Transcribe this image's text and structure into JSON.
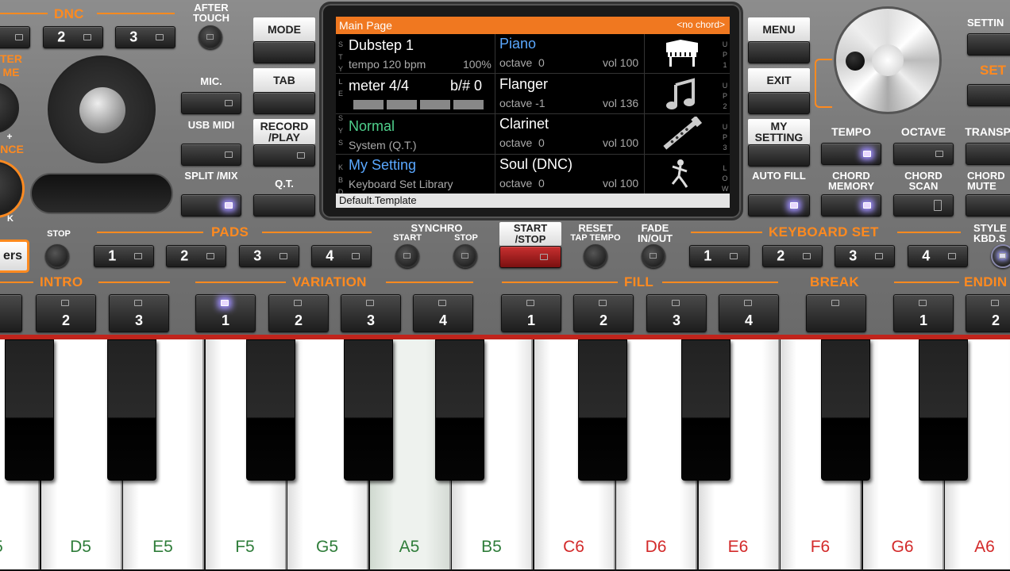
{
  "sections": {
    "dnc": "DNC",
    "pads": "PADS",
    "keyboard_set": "KEYBOARD SET",
    "intro": "INTRO",
    "variation": "VARIATION",
    "fill": "FILL",
    "break": "BREAK",
    "ending": "ENDIN"
  },
  "top_left": {
    "dnc_buttons": [
      "2",
      "3"
    ],
    "after_touch": "AFTER TOUCH",
    "ulab1": "TER\nME",
    "ulab2": "NCE",
    "plus": "+",
    "k": "K"
  },
  "mid_labels": {
    "mic": "MIC.",
    "usb_midi": "USB MIDI",
    "split_mix": "SPLIT /MIX",
    "mode": "MODE",
    "tab": "TAB",
    "record_play": "RECORD /PLAY",
    "qt": "Q.T.",
    "menu": "MENU",
    "exit": "EXIT",
    "my_setting": "MY SETTING",
    "auto_fill": "AUTO FILL"
  },
  "right_labels": {
    "setting": "SETTIN",
    "set": "SET",
    "tempo": "TEMPO",
    "octave": "OCTAVE",
    "transp": "TRANSP",
    "chord_memory": "CHORD MEMORY",
    "chord_scan": "CHORD SCAN",
    "chord_mute": "CHORD MUTE",
    "style_kbd": "STYLE KBD.S"
  },
  "screen": {
    "title": "Main Page",
    "no_chord": "<no chord>",
    "style_name": "Dubstep 1",
    "tempo": "tempo 120 bpm",
    "pct": "100%",
    "meter": "meter 4/4",
    "bsharp": "b/# 0",
    "sys_name": "Normal",
    "sys_sub": "System (Q.T.)",
    "kbd_name": "My Setting",
    "kbd_sub": "Keyboard Set Library",
    "footer": "Default.Template",
    "side_left": [
      "S",
      "T",
      "Y",
      "L",
      "E",
      "",
      "S",
      "Y",
      "S",
      "",
      "K",
      "B",
      "D"
    ],
    "side_right": [
      "U",
      "P",
      "1",
      "",
      "U",
      "P",
      "2",
      "",
      "U",
      "P",
      "3",
      "",
      "L",
      "O",
      "W"
    ],
    "tracks": [
      {
        "name": "Piano",
        "octave": "octave  0",
        "vol": "vol 100",
        "icon": "piano-icon"
      },
      {
        "name": "Flanger",
        "octave": "octave -1",
        "vol": "vol 136",
        "icon": "music-note-icon"
      },
      {
        "name": "Clarinet",
        "octave": "octave  0",
        "vol": "vol 100",
        "icon": "clarinet-icon"
      },
      {
        "name": "Soul (DNC)",
        "octave": "octave  0",
        "vol": "vol 100",
        "icon": "dancer-icon"
      }
    ]
  },
  "row2": {
    "ers": "ers",
    "stop": "STOP",
    "pads": [
      "1",
      "2",
      "3",
      "4"
    ],
    "synchro": "SYNCHRO",
    "sync_start": "START",
    "sync_stop": "STOP",
    "start_stop": "START /STOP",
    "reset": "RESET",
    "tap_tempo": "TAP TEMPO",
    "fade": "FADE IN/OUT",
    "kbd_set": [
      "1",
      "2",
      "3",
      "4"
    ]
  },
  "row3": {
    "intro": [
      "2",
      "3"
    ],
    "variation": [
      "1",
      "2",
      "3",
      "4"
    ],
    "fill": [
      "1",
      "2",
      "3",
      "4"
    ],
    "ending": [
      "1",
      "2"
    ]
  },
  "keys": {
    "white": [
      "5",
      "D5",
      "E5",
      "F5",
      "G5",
      "A5",
      "B5",
      "C6",
      "D6",
      "E6",
      "F6",
      "G6",
      "A6"
    ]
  },
  "colors": {
    "accent": "#ff8a1f",
    "lcd_header": "#f07820",
    "green_note": "#2f7d3a",
    "red_note": "#d32a2a"
  }
}
